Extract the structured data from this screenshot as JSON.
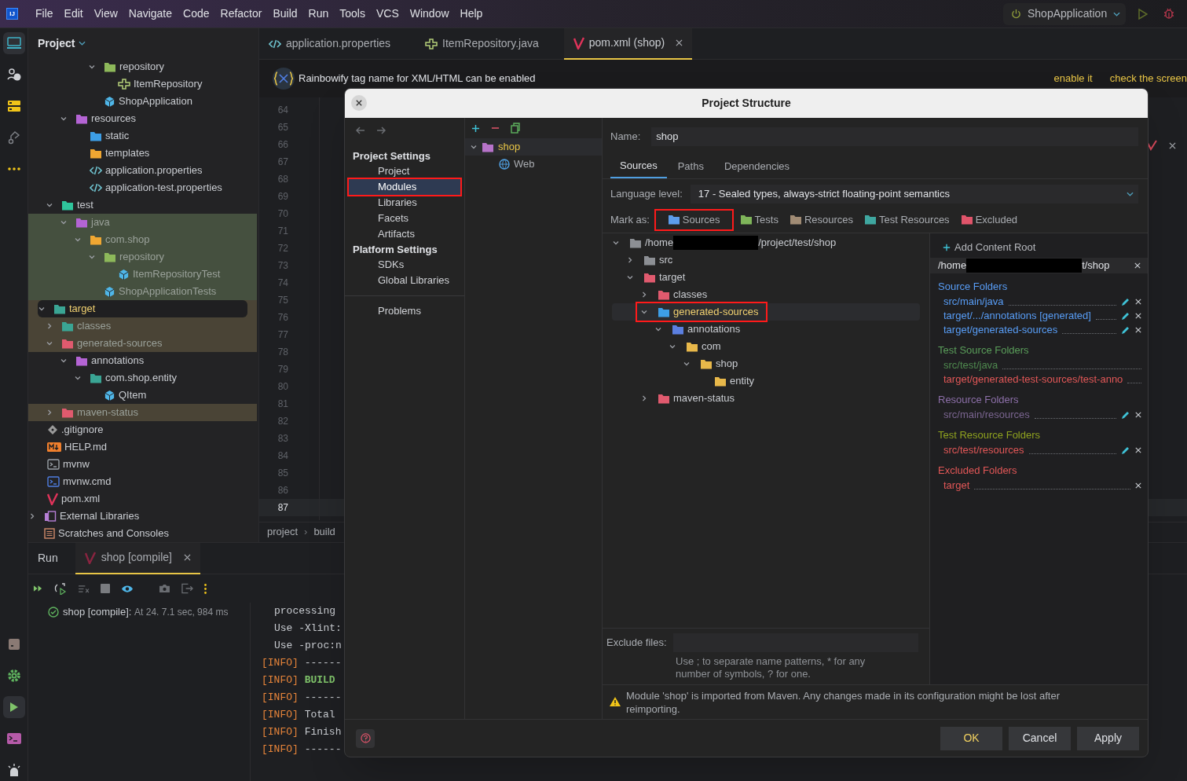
{
  "menu_bar": {
    "logo": "IJ",
    "items": [
      "File",
      "Edit",
      "View",
      "Navigate",
      "Code",
      "Refactor",
      "Build",
      "Run",
      "Tools",
      "VCS",
      "Window",
      "Help"
    ],
    "run_config": "ShopApplication"
  },
  "tool_strip": {
    "top": [
      {
        "kind": "project",
        "selected": true
      },
      {
        "kind": "help",
        "selected": false
      },
      {
        "kind": "structure",
        "selected": false
      },
      {
        "kind": "git",
        "selected": false
      },
      {
        "kind": "more",
        "selected": false
      }
    ],
    "bottom": [
      {
        "kind": "package",
        "selected": false
      },
      {
        "kind": "services",
        "selected": false
      },
      {
        "kind": "run",
        "selected": true
      },
      {
        "kind": "terminal",
        "selected": false
      },
      {
        "kind": "notifications",
        "selected": false
      }
    ]
  },
  "project_panel": {
    "title": "Project",
    "tree": [
      {
        "children": [
          {
            "children": [
              {
                "children": [
                  {
                    "children": [
                      {
                        "children": [
                          {
                            "name": "repository",
                            "kind": "folder-green",
                            "expanded": true,
                            "selected": false,
                            "children": [
                              {
                                "name": "ItemRepository",
                                "kind": "interface",
                                "selected": false
                              }
                            ]
                          },
                          {
                            "name": "ShopApplication",
                            "kind": "class-app",
                            "selected": false
                          }
                        ]
                      }
                    ]
                  },
                  {
                    "name": "resources",
                    "kind": "folder-purple",
                    "expanded": true,
                    "selected": false,
                    "children": [
                      {
                        "name": "static",
                        "kind": "folder-blue",
                        "selected": false
                      },
                      {
                        "name": "templates",
                        "kind": "folder-orange",
                        "selected": false
                      },
                      {
                        "name": "application.properties",
                        "kind": "properties",
                        "selected": false
                      },
                      {
                        "name": "application-test.properties",
                        "kind": "properties",
                        "selected": false
                      }
                    ]
                  }
                ]
              },
              {
                "name": "test",
                "kind": "folder-test",
                "expanded": true,
                "selected": false,
                "children": [
                  {
                    "name": "java",
                    "kind": "folder-purple",
                    "expanded": true,
                    "selected": false,
                    "test": true,
                    "children": [
                      {
                        "name": "com.shop",
                        "kind": "folder-orange",
                        "expanded": true,
                        "selected": false,
                        "test": true,
                        "children": [
                          {
                            "name": "repository",
                            "kind": "folder-green",
                            "expanded": true,
                            "selected": false,
                            "test": true,
                            "children": [
                              {
                                "name": "ItemRepositoryTest",
                                "kind": "class",
                                "selected": false,
                                "test": true
                              }
                            ]
                          },
                          {
                            "name": "ShopApplicationTests",
                            "kind": "class",
                            "selected": false,
                            "test": true
                          }
                        ]
                      }
                    ]
                  }
                ]
              }
            ]
          },
          {
            "name": "target",
            "kind": "folder-teal",
            "expanded": true,
            "selected": true,
            "excluded": true,
            "children": [
              {
                "name": "classes",
                "kind": "folder-teal",
                "expanded": false,
                "selected": false,
                "excluded": true
              },
              {
                "name": "generated-sources",
                "kind": "folder-red",
                "expanded": true,
                "selected": false,
                "excluded": true,
                "children": [
                  {
                    "name": "annotations",
                    "kind": "folder-purple",
                    "expanded": true,
                    "selected": false,
                    "children": [
                      {
                        "name": "com.shop.entity",
                        "kind": "folder-teal",
                        "expanded": true,
                        "selected": false,
                        "children": [
                          {
                            "name": "QItem",
                            "kind": "class",
                            "selected": false
                          }
                        ]
                      }
                    ]
                  }
                ]
              },
              {
                "name": "maven-status",
                "kind": "folder-red",
                "expanded": false,
                "selected": false,
                "excluded": true
              }
            ]
          },
          {
            "name": ".gitignore",
            "kind": "git",
            "selected": false
          },
          {
            "name": "HELP.md",
            "kind": "markdown",
            "selected": false
          },
          {
            "name": "mvnw",
            "kind": "shell",
            "selected": false
          },
          {
            "name": "mvnw.cmd",
            "kind": "cmd",
            "selected": false
          },
          {
            "name": "pom.xml",
            "kind": "maven",
            "selected": false
          }
        ]
      },
      {
        "name": "External Libraries",
        "kind": "library",
        "expanded": false,
        "selected": false
      },
      {
        "name": "Scratches and Consoles",
        "kind": "scratches",
        "selected": false
      }
    ]
  },
  "editor": {
    "tabs": [
      {
        "label": "application.properties",
        "kind": "properties",
        "selected": false
      },
      {
        "label": "ItemRepository.java",
        "kind": "interface",
        "selected": false
      },
      {
        "label": "pom.xml (shop)",
        "kind": "maven",
        "selected": true
      }
    ],
    "banner": {
      "text": "Rainbowify tag name for XML/HTML can be enabled",
      "actions": [
        "enable it",
        "check the screen"
      ]
    },
    "line_numbers": [
      {
        "number": "64",
        "current": false
      },
      {
        "number": "65",
        "current": false
      },
      {
        "number": "66",
        "current": false
      },
      {
        "number": "67",
        "current": false
      },
      {
        "number": "68",
        "current": false
      },
      {
        "number": "69",
        "current": false
      },
      {
        "number": "70",
        "current": false
      },
      {
        "number": "71",
        "current": false
      },
      {
        "number": "72",
        "current": false
      },
      {
        "number": "73",
        "current": false
      },
      {
        "number": "74",
        "current": false
      },
      {
        "number": "75",
        "current": false
      },
      {
        "number": "76",
        "current": false
      },
      {
        "number": "77",
        "current": false
      },
      {
        "number": "78",
        "current": false
      },
      {
        "number": "79",
        "current": false
      },
      {
        "number": "80",
        "current": false
      },
      {
        "number": "81",
        "current": false
      },
      {
        "number": "82",
        "current": false
      },
      {
        "number": "83",
        "current": false
      },
      {
        "number": "84",
        "current": false
      },
      {
        "number": "85",
        "current": false
      },
      {
        "number": "86",
        "current": false
      },
      {
        "number": "87",
        "current": true
      }
    ],
    "breadcrumbs": [
      "project",
      "build"
    ],
    "breadcrumb_separator": "›"
  },
  "run_panel": {
    "title": "Run",
    "tabs": [
      {
        "label": "shop [compile]",
        "selected": true
      }
    ],
    "result": {
      "label": "shop [compile]:",
      "detail": "At 24. 7.1 sec, 984 ms"
    },
    "console": [
      {
        "kind": "plain",
        "text": "processing"
      },
      {
        "kind": "plain",
        "text": "Use -Xlint:"
      },
      {
        "kind": "plain",
        "text": "Use -proc:n"
      },
      {
        "kind": "info",
        "tag": "[INFO]",
        "text": "------"
      },
      {
        "kind": "success",
        "tag": "[INFO]",
        "text": "BUILD"
      },
      {
        "kind": "info",
        "tag": "[INFO]",
        "text": "------"
      },
      {
        "kind": "info",
        "tag": "[INFO]",
        "text": "Total"
      },
      {
        "kind": "info",
        "tag": "[INFO]",
        "text": "Finish"
      },
      {
        "kind": "info",
        "tag": "[INFO]",
        "text": "------"
      }
    ]
  },
  "dialog": {
    "title": "Project Structure",
    "nav": [
      {
        "kind": "header",
        "label": "Project Settings"
      },
      {
        "kind": "item",
        "label": "Project",
        "selected": false,
        "annotated": false
      },
      {
        "kind": "item",
        "label": "Modules",
        "selected": true,
        "annotated": true
      },
      {
        "kind": "item",
        "label": "Libraries",
        "selected": false,
        "annotated": false
      },
      {
        "kind": "item",
        "label": "Facets",
        "selected": false,
        "annotated": false
      },
      {
        "kind": "item",
        "label": "Artifacts",
        "selected": false,
        "annotated": false
      },
      {
        "kind": "header",
        "label": "Platform Settings"
      },
      {
        "kind": "item",
        "label": "SDKs",
        "selected": false,
        "annotated": false
      },
      {
        "kind": "item",
        "label": "Global Libraries",
        "selected": false,
        "annotated": false
      },
      {
        "kind": "separator"
      },
      {
        "kind": "item",
        "label": "Problems",
        "selected": false,
        "annotated": false
      }
    ],
    "modules": [
      {
        "name": "shop",
        "expanded": true,
        "selected": true,
        "children": [
          {
            "name": "Web",
            "selected": false
          }
        ]
      }
    ],
    "name_label": "Name:",
    "name_value": "shop",
    "tabs": [
      {
        "label": "Sources",
        "selected": true
      },
      {
        "label": "Paths",
        "selected": false
      },
      {
        "label": "Dependencies",
        "selected": false
      }
    ],
    "language_level_label": "Language level:",
    "language_level": "17 - Sealed types, always-strict floating-point semantics",
    "mark_as_label": "Mark as:",
    "mark_as": [
      {
        "label": "Sources",
        "color": "#5c9ded",
        "annotated": true
      },
      {
        "label": "Tests",
        "color": "#7fb55a",
        "annotated": false
      },
      {
        "label": "Resources",
        "color": "#a08b74",
        "annotated": false
      },
      {
        "label": "Test Resources",
        "color": "#3fa7a0",
        "annotated": false
      },
      {
        "label": "Excluded",
        "color": "#e0546a",
        "annotated": false
      }
    ],
    "content_tree": [
      {
        "path_start": "/home",
        "path_end": "/project/test/shop",
        "redacted": true,
        "kind": "folder-grey",
        "expanded": true,
        "selected": false,
        "annotated": false,
        "children": [
          {
            "name": "src",
            "kind": "folder-grey",
            "expanded": false,
            "selected": false,
            "annotated": false
          },
          {
            "name": "target",
            "kind": "folder-red",
            "expanded": true,
            "selected": false,
            "annotated": false,
            "children": [
              {
                "name": "classes",
                "kind": "folder-red",
                "expanded": false,
                "selected": false,
                "annotated": false
              },
              {
                "name": "generated-sources",
                "kind": "folder-blue",
                "expanded": true,
                "selected": true,
                "annotated": true,
                "children": [
                  {
                    "name": "annotations",
                    "kind": "folder-code",
                    "expanded": true,
                    "selected": false,
                    "annotated": false,
                    "children": [
                      {
                        "name": "com",
                        "kind": "package",
                        "expanded": true,
                        "selected": false,
                        "annotated": false,
                        "children": [
                          {
                            "name": "shop",
                            "kind": "package",
                            "expanded": true,
                            "selected": false,
                            "annotated": false,
                            "children": [
                              {
                                "name": "entity",
                                "kind": "package",
                                "selected": false,
                                "annotated": false
                              }
                            ]
                          }
                        ]
                      }
                    ]
                  }
                ]
              },
              {
                "name": "maven-status",
                "kind": "folder-red",
                "expanded": false,
                "selected": false,
                "annotated": false
              }
            ]
          }
        ]
      }
    ],
    "add_content_root": "Add Content Root",
    "content_root": {
      "path_start": "/home",
      "path_end": "t/shop",
      "redacted": true
    },
    "folder_groups": [
      {
        "title": "Source Folders",
        "color": "#589df6",
        "items": [
          {
            "path": "src/main/java",
            "color": "#589df6",
            "editable": true,
            "removable": true
          },
          {
            "path": "target/.../annotations [generated]",
            "color": "#589df6",
            "editable": true,
            "removable": true
          },
          {
            "path": "target/generated-sources",
            "color": "#589df6",
            "editable": true,
            "removable": true
          }
        ]
      },
      {
        "title": "Test Source Folders",
        "color": "#5a9e5a",
        "items": [
          {
            "path": "src/test/java",
            "color": "#4f8a4f",
            "editable": false,
            "removable": false
          },
          {
            "path": "target/generated-test-sources/test-anno",
            "color": "#e25757",
            "editable": false,
            "removable": false
          }
        ]
      },
      {
        "title": "Resource Folders",
        "color": "#8c6fa8",
        "items": [
          {
            "path": "src/main/resources",
            "color": "#7a6590",
            "editable": true,
            "removable": true
          }
        ]
      },
      {
        "title": "Test Resource Folders",
        "color": "#8fa21f",
        "items": [
          {
            "path": "src/test/resources",
            "color": "#e25757",
            "editable": true,
            "removable": true
          }
        ]
      },
      {
        "title": "Excluded Folders",
        "color": "#e25757",
        "items": [
          {
            "path": "target",
            "color": "#e25757",
            "editable": false,
            "removable": true
          }
        ]
      }
    ],
    "exclude_label": "Exclude files:",
    "exclude_hint": "Use ; to separate name patterns, * for any number of symbols, ? for one.",
    "warning": "Module 'shop' is imported from Maven. Any changes made in its configuration might be lost after reimporting.",
    "buttons": [
      {
        "label": "OK",
        "kind": "default"
      },
      {
        "label": "Cancel",
        "kind": "normal"
      },
      {
        "label": "Apply",
        "kind": "normal"
      }
    ]
  }
}
